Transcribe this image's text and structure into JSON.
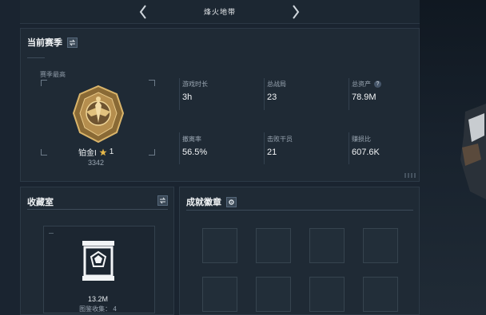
{
  "header": {
    "title": "烽火地带"
  },
  "season": {
    "title": "当前赛季",
    "best_label": "赛季最高",
    "rank_name": "铂金I",
    "rank_level": "1",
    "rank_score": "3342",
    "stats": [
      {
        "label": "游戏时长",
        "value": "3h"
      },
      {
        "label": "总战局",
        "value": "23"
      },
      {
        "label": "总资产",
        "value": "78.9M",
        "help": "?"
      },
      {
        "label": "撤离率",
        "value": "56.5%"
      },
      {
        "label": "击败干员",
        "value": "21"
      },
      {
        "label": "赚损比",
        "value": "607.6K"
      }
    ]
  },
  "collection": {
    "title": "收藏室",
    "value": "13.2M",
    "count_label": "图鉴收集：",
    "count": "4"
  },
  "badges": {
    "title": "成就徽章"
  },
  "colors": {
    "panel": "#1f2a35",
    "accent_gold": "#c9a24f",
    "star": "#e6b84a"
  }
}
